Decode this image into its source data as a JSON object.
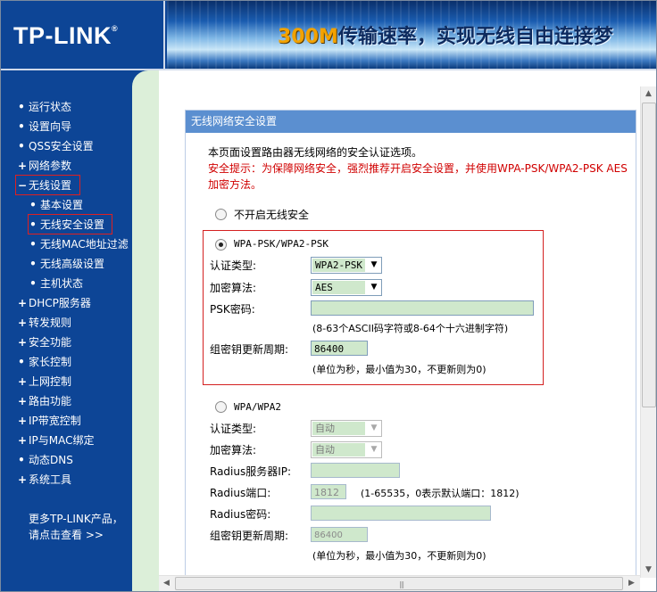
{
  "header": {
    "logo": "TP-LINK",
    "logo_mark": "®",
    "banner_highlight": "300M",
    "banner_text": "传输速率，实现无线自由连接梦"
  },
  "sidebar": {
    "items": [
      {
        "marker": "•",
        "label": "运行状态"
      },
      {
        "marker": "•",
        "label": "设置向导"
      },
      {
        "marker": "•",
        "label": "QSS安全设置"
      },
      {
        "marker": "+",
        "label": "网络参数"
      },
      {
        "marker": "−",
        "label": "无线设置"
      },
      {
        "marker": "•",
        "label": "基本设置"
      },
      {
        "marker": "•",
        "label": "无线安全设置"
      },
      {
        "marker": "•",
        "label": "无线MAC地址过滤"
      },
      {
        "marker": "•",
        "label": "无线高级设置"
      },
      {
        "marker": "•",
        "label": "主机状态"
      },
      {
        "marker": "+",
        "label": "DHCP服务器"
      },
      {
        "marker": "+",
        "label": "转发规则"
      },
      {
        "marker": "+",
        "label": "安全功能"
      },
      {
        "marker": "•",
        "label": "家长控制"
      },
      {
        "marker": "+",
        "label": "上网控制"
      },
      {
        "marker": "+",
        "label": "路由功能"
      },
      {
        "marker": "+",
        "label": "IP带宽控制"
      },
      {
        "marker": "+",
        "label": "IP与MAC绑定"
      },
      {
        "marker": "•",
        "label": "动态DNS"
      },
      {
        "marker": "+",
        "label": "系统工具"
      }
    ],
    "more_line1": "更多TP-LINK产品，",
    "more_line2": "请点击查看 >>"
  },
  "panel": {
    "title": "无线网络安全设置",
    "intro": "本页面设置路由器无线网络的安全认证选项。",
    "tip_line1": "安全提示：为保障网络安全，强烈推荐开启安全设置，并使用WPA-PSK/WPA2-PSK AES",
    "tip_line2": "加密方法。",
    "option_none": "不开启无线安全",
    "psk": {
      "option_label": "WPA-PSK/WPA2-PSK",
      "auth_label": "认证类型:",
      "auth_value": "WPA2-PSK",
      "enc_label": "加密算法:",
      "enc_value": "AES",
      "pwd_label": "PSK密码:",
      "pwd_value": "",
      "pwd_hint": "(8-63个ASCII码字符或8-64个十六进制字符)",
      "renew_label": "组密钥更新周期:",
      "renew_value": "86400",
      "renew_hint": "(单位为秒，最小值为30，不更新则为0)"
    },
    "wpa": {
      "option_label": "WPA/WPA2",
      "auth_label": "认证类型:",
      "auth_value": "自动",
      "enc_label": "加密算法:",
      "enc_value": "自动",
      "radius_ip_label": "Radius服务器IP:",
      "radius_ip_value": "",
      "radius_port_label": "Radius端口:",
      "radius_port_value": "1812",
      "radius_port_hint": "(1-65535，0表示默认端口：1812)",
      "radius_pwd_label": "Radius密码:",
      "radius_pwd_value": "",
      "renew_label": "组密钥更新周期:",
      "renew_value": "86400",
      "renew_hint": "(单位为秒，最小值为30，不更新则为0)"
    }
  }
}
